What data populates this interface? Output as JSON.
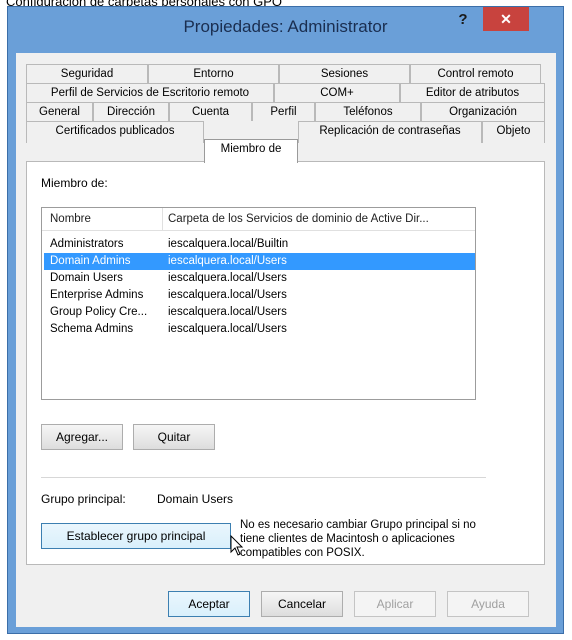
{
  "caption": "Configuración de carpetas personales con GPO",
  "window": {
    "title": "Propiedades: Administrator",
    "help": "?",
    "close": "✕"
  },
  "tabs": {
    "row1": [
      "Seguridad",
      "Entorno",
      "Sesiones",
      "Control remoto"
    ],
    "row2": [
      "Perfil de Servicios de Escritorio remoto",
      "COM+",
      "Editor de atributos"
    ],
    "row3": [
      "General",
      "Dirección",
      "Cuenta",
      "Perfil",
      "Teléfonos",
      "Organización"
    ],
    "row4": [
      "Certificados publicados",
      "Miembro de",
      "Replicación de contraseñas",
      "Objeto"
    ],
    "active": "Miembro de"
  },
  "member_of": {
    "label": "Miembro de:",
    "columns": [
      "Nombre",
      "Carpeta de los Servicios de dominio de Active Dir..."
    ],
    "rows": [
      {
        "name": "Administrators",
        "folder": "iescalquera.local/Builtin"
      },
      {
        "name": "Domain Admins",
        "folder": "iescalquera.local/Users"
      },
      {
        "name": "Domain Users",
        "folder": "iescalquera.local/Users"
      },
      {
        "name": "Enterprise Admins",
        "folder": "iescalquera.local/Users"
      },
      {
        "name": "Group Policy Cre...",
        "folder": "iescalquera.local/Users"
      },
      {
        "name": "Schema Admins",
        "folder": "iescalquera.local/Users"
      }
    ],
    "selected_row": "Domain Admins",
    "add_button": "Agregar...",
    "remove_button": "Quitar"
  },
  "primary_group": {
    "label": "Grupo principal:",
    "value": "Domain Users",
    "set_button": "Establecer grupo principal",
    "note": "No es necesario cambiar Grupo principal si no tiene clientes de Macintosh o aplicaciones compatibles con POSIX."
  },
  "footer": {
    "ok": "Aceptar",
    "cancel": "Cancelar",
    "apply": "Aplicar",
    "help": "Ayuda"
  },
  "colors": {
    "title_bar": "#6a9fd8",
    "close_button": "#c8433e",
    "selection": "#3399ff"
  }
}
